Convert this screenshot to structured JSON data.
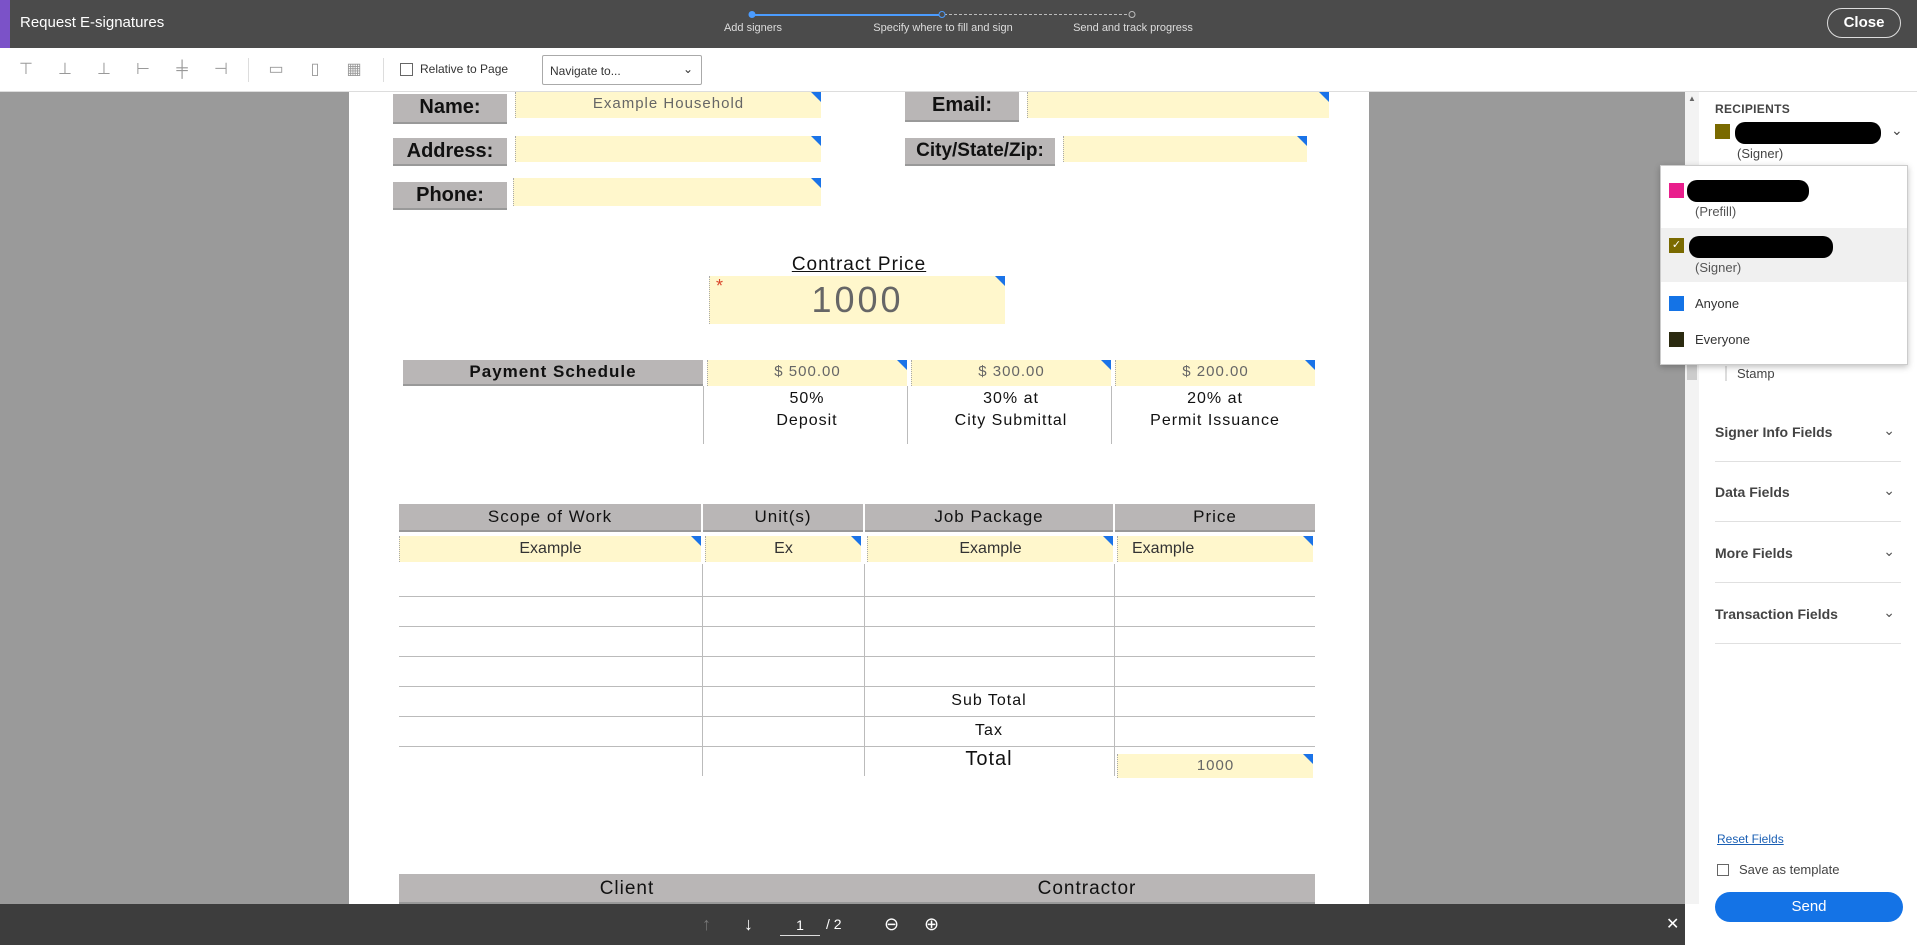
{
  "header": {
    "title": "Request E-signatures",
    "steps": [
      {
        "label": "Add signers"
      },
      {
        "label": "Specify where to fill and sign"
      },
      {
        "label": "Send and track progress"
      }
    ],
    "close_label": "Close"
  },
  "toolbar": {
    "relative_label": "Relative to Page",
    "navigate_placeholder": "Navigate to..."
  },
  "form": {
    "name_label": "Name:",
    "name_value": "Example Household",
    "email_label": "Email:",
    "address_label": "Address:",
    "city_label": "City/State/Zip:",
    "phone_label": "Phone:",
    "contract_price_label": "Contract Price",
    "contract_price_value": "1000",
    "payment_schedule_label": "Payment Schedule",
    "payments": [
      {
        "amount": "$ 500.00",
        "line1": "50%",
        "line2": "Deposit"
      },
      {
        "amount": "$ 300.00",
        "line1": "30% at",
        "line2": "City Submittal"
      },
      {
        "amount": "$ 200.00",
        "line1": "20% at",
        "line2": "Permit Issuance"
      }
    ],
    "table_headers": [
      "Scope of Work",
      "Unit(s)",
      "Job Package",
      "Price"
    ],
    "first_row": [
      "Example",
      "Ex",
      "Example",
      "Example"
    ],
    "subtotal_label": "Sub Total",
    "tax_label": "Tax",
    "total_label": "Total",
    "total_value": "1000",
    "client_label": "Client",
    "contractor_label": "Contractor"
  },
  "pager": {
    "current": "1",
    "total": "/ 2"
  },
  "sidebar": {
    "recipients_title": "RECIPIENTS",
    "selected_role": "(Signer)",
    "stamp_label": "Stamp",
    "sections": [
      "Signer Info Fields",
      "Data Fields",
      "More Fields",
      "Transaction Fields"
    ],
    "reset_label": "Reset Fields",
    "save_template_label": "Save as template",
    "send_label": "Send"
  },
  "dropdown": {
    "items": [
      {
        "role": "(Prefill)",
        "color": "#e91e8c"
      },
      {
        "role": "(Signer)",
        "color": "#7a6a00"
      },
      {
        "name": "Anyone",
        "color": "#1473e6"
      },
      {
        "name": "Everyone",
        "color": "#2b2a10"
      }
    ]
  },
  "colors": {
    "accent": "#1473e6",
    "header_bg": "#4b4b4b",
    "field_bg": "#fff7cc"
  }
}
